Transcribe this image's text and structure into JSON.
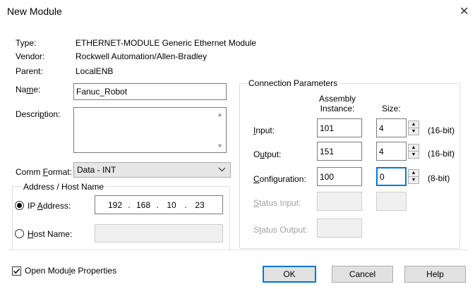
{
  "window": {
    "title": "New Module",
    "close_glyph": "✕"
  },
  "info": {
    "type_label": "Type:",
    "type_value": "ETHERNET-MODULE Generic Ethernet Module",
    "vendor_label": "Vendor:",
    "vendor_value": "Rockwell Automation/Allen-Bradley",
    "parent_label": "Parent:",
    "parent_value": "LocalENB"
  },
  "name": {
    "label_pre": "Na",
    "label_ul": "m",
    "label_post": "e:",
    "value": "Fanuc_Robot"
  },
  "description": {
    "label_pre": "Descri",
    "label_ul": "p",
    "label_post": "tion:",
    "value": ""
  },
  "comm_format": {
    "label_pre": "Comm ",
    "label_ul": "F",
    "label_post": "ormat:",
    "value": "Data - INT"
  },
  "address": {
    "group_title": "Address / Host Name",
    "ip_label_pre": "IP ",
    "ip_label_ul": "A",
    "ip_label_post": "ddress:",
    "ip_octets": [
      "192",
      "168",
      "10",
      "23"
    ],
    "host_label_pre": "",
    "host_label_ul": "H",
    "host_label_post": "ost Name:",
    "host_value": "",
    "selected": "ip"
  },
  "connection": {
    "group_title": "Connection Parameters",
    "col_assembly_line1": "Assembly",
    "col_assembly_line2": "Instance:",
    "col_size": "Size:",
    "rows": [
      {
        "pre": "",
        "ul": "I",
        "post": "nput:",
        "instance": "101",
        "size": "4",
        "unit": "(16-bit)",
        "enabled": true
      },
      {
        "pre": "O",
        "ul": "u",
        "post": "tput:",
        "instance": "151",
        "size": "4",
        "unit": "(16-bit)",
        "enabled": true
      },
      {
        "pre": "",
        "ul": "C",
        "post": "onfiguration:",
        "instance": "100",
        "size": "0",
        "unit": "(8-bit)",
        "enabled": true
      },
      {
        "pre": "",
        "ul": "S",
        "post": "tatus Input:",
        "instance": "",
        "size": "",
        "unit": "",
        "enabled": false
      },
      {
        "pre": "S",
        "ul": "t",
        "post": "atus Output:",
        "instance": "",
        "size": "",
        "unit": "",
        "enabled": false
      }
    ]
  },
  "footer": {
    "open_props_pre": "Open Modu",
    "open_props_ul": "l",
    "open_props_post": "e Properties",
    "open_props_checked": true,
    "ok_label": "OK",
    "cancel_label": "Cancel",
    "help_label": "Help"
  },
  "icons": {
    "close": "close-icon",
    "dropdown": "chevron-down-icon",
    "spin_up": "spin-up-icon",
    "spin_down": "spin-down-icon",
    "checkmark": "checkmark-icon"
  },
  "colors": {
    "default_button_border": "#0078d7",
    "disabled_text": "#a0a0a0"
  }
}
